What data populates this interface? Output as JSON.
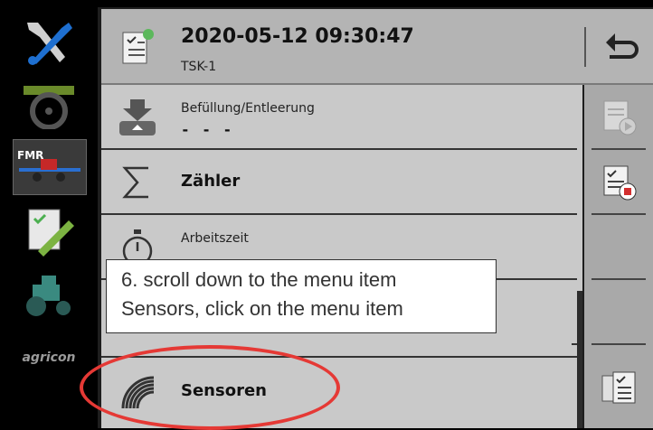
{
  "header": {
    "title": "2020-05-12 09:30:47",
    "subtitle": "TSK-1"
  },
  "left_apps": [
    {
      "name": "settings-tools"
    },
    {
      "name": "steering"
    },
    {
      "name": "fmr",
      "label": "FMR"
    },
    {
      "name": "task-controller"
    },
    {
      "name": "tractor"
    },
    {
      "name": "agricon",
      "label": "agricon"
    }
  ],
  "menu": {
    "items": [
      {
        "label": "Befüllung/Entleerung",
        "value": "- - -"
      },
      {
        "label": "Zähler"
      },
      {
        "label": "Arbeitszeit"
      },
      {
        "label": "Sensoren"
      }
    ]
  },
  "callout": {
    "line1": "6. scroll down to the menu item",
    "line2": "Sensors, click on the menu item"
  },
  "colors": {
    "highlight": "#e53935"
  }
}
